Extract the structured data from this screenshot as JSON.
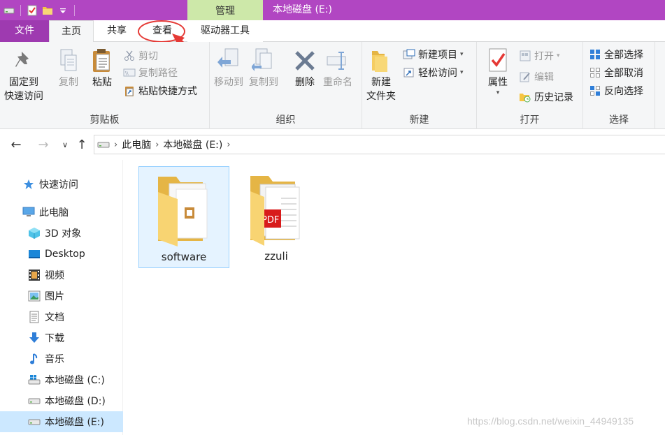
{
  "titlebar": {
    "context_tab": "管理",
    "window_title": "本地磁盘 (E:)",
    "quick_access_icons": [
      "drive-icon",
      "properties-check-icon",
      "new-folder-icon",
      "customize-dropdown-icon"
    ]
  },
  "tabs": {
    "file": "文件",
    "home": "主页",
    "share": "共享",
    "view": "查看",
    "drive_tools": "驱动器工具"
  },
  "ribbon": {
    "clipboard": {
      "label": "剪贴板",
      "pin": "固定到\n快速访问",
      "copy": "复制",
      "paste": "粘贴",
      "cut": "剪切",
      "copy_path": "复制路径",
      "paste_shortcut": "粘贴快捷方式"
    },
    "organize": {
      "label": "组织",
      "move_to": "移动到",
      "copy_to": "复制到",
      "delete": "删除",
      "rename": "重命名"
    },
    "new": {
      "label": "新建",
      "new_folder": "新建\n文件夹",
      "new_item": "新建项目",
      "easy_access": "轻松访问"
    },
    "open": {
      "label": "打开",
      "properties": "属性",
      "open": "打开",
      "edit": "编辑",
      "history": "历史记录"
    },
    "select": {
      "label": "选择",
      "select_all": "全部选择",
      "select_none": "全部取消",
      "invert": "反向选择"
    }
  },
  "address": {
    "crumbs": [
      "此电脑",
      "本地磁盘 (E:)"
    ]
  },
  "navpane": {
    "quick_access": "快速访问",
    "this_pc": "此电脑",
    "items": [
      "3D 对象",
      "Desktop",
      "视频",
      "图片",
      "文档",
      "下载",
      "音乐",
      "本地磁盘 (C:)",
      "本地磁盘 (D:)",
      "本地磁盘 (E:)"
    ]
  },
  "files": [
    {
      "name": "software",
      "selected": true
    },
    {
      "name": "zzuli",
      "selected": false
    }
  ],
  "watermark": "https://blog.csdn.net/weixin_44949135",
  "colors": {
    "titlebar": "#b146c2",
    "file_tab": "#9e3ab0",
    "context_tab": "#cde8a9",
    "selection": "#cce8ff",
    "annotation": "#e53935"
  }
}
